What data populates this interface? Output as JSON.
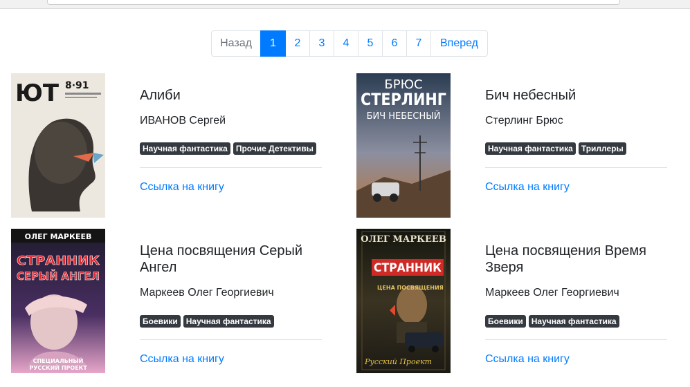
{
  "pagination": {
    "prev_label": "Назад",
    "pages": [
      "1",
      "2",
      "3",
      "4",
      "5",
      "6",
      "7"
    ],
    "active_page": "1",
    "next_label": "Вперед"
  },
  "books": [
    {
      "title": "Алиби",
      "author": "ИВАНОВ Сергей",
      "tags": [
        "Научная фантастика",
        "Прочие Детективы"
      ],
      "link_label": "Ссылка на книгу",
      "cover_text": {
        "line1": "ЮТ",
        "line2": "8·91"
      }
    },
    {
      "title": "Бич небесный",
      "author": "Стерлинг Брюс",
      "tags": [
        "Научная фантастика",
        "Триллеры"
      ],
      "link_label": "Ссылка на книгу",
      "cover_text": {
        "line1": "БРЮС",
        "line2": "СТЕРЛИНГ",
        "line3": "БИЧ НЕБЕСНЫЙ"
      }
    },
    {
      "title": "Цена посвящения Серый Ангел",
      "author": "Маркеев Олег Георгиевич",
      "tags": [
        "Боевики",
        "Научная фантастика"
      ],
      "link_label": "Ссылка на книгу",
      "cover_text": {
        "line1": "ОЛЕГ МАРКЕЕВ",
        "line2": "СТРАННИК",
        "line3": "СЕРЫЙ АНГЕЛ",
        "line4": "СПЕЦИАЛЬНЫЙ",
        "line5": "РУССКИЙ ПРОЕКТ"
      }
    },
    {
      "title": "Цена посвящения Время Зверя",
      "author": "Маркеев Олег Георгиевич",
      "tags": [
        "Боевики",
        "Научная фантастика"
      ],
      "link_label": "Ссылка на книгу",
      "cover_text": {
        "line1": "ОЛЕГ МАРКЕЕВ",
        "line2": "СТРАННИК",
        "line3": "ЦЕНА ПОСВЯЩЕНИЯ",
        "line4": "Русский Проект"
      }
    }
  ],
  "colors": {
    "link": "#007bff",
    "active_page_bg": "#007bff",
    "tag_bg": "#343a40"
  }
}
